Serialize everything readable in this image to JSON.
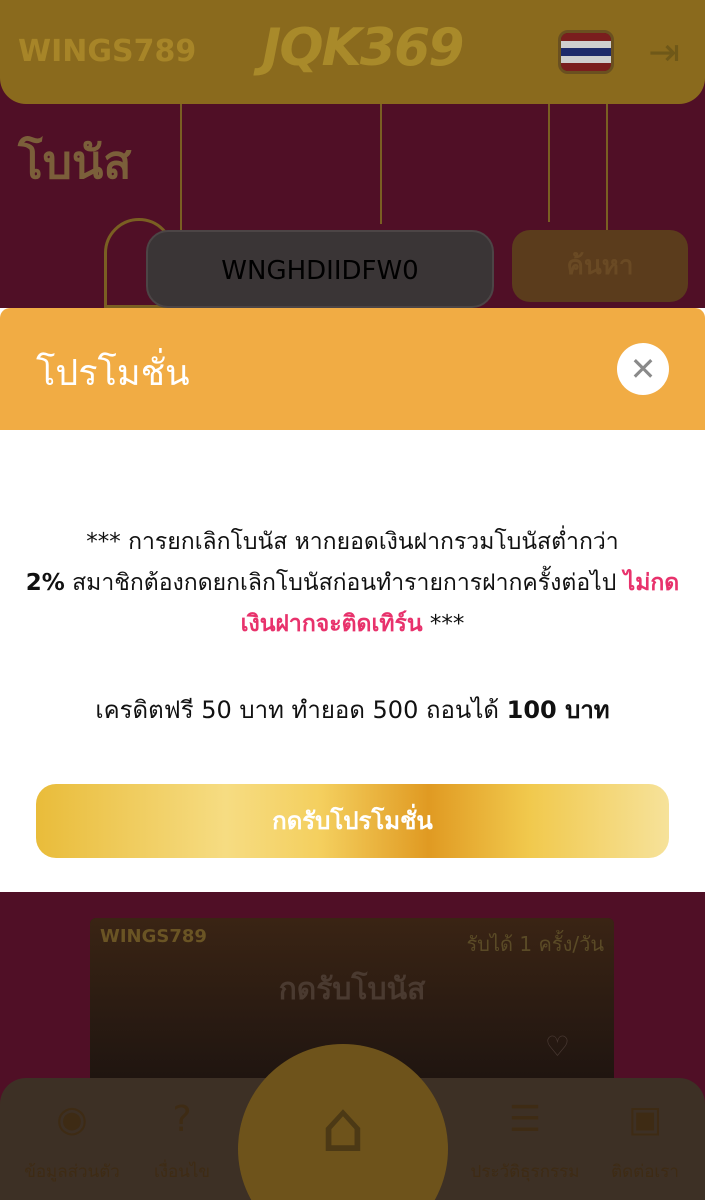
{
  "header": {
    "brand": "WINGS789",
    "logo": "JQK369",
    "flag_icon": "thailand-flag-icon",
    "logout_icon": "logout-icon"
  },
  "page": {
    "title": "โบนัส",
    "search_value": "WNGHDIIDFW0",
    "search_button": "ค้นหา"
  },
  "modal": {
    "title": "โปรโมชั่น",
    "close_icon": "close-icon",
    "text_part1": "*** การยกเลิกโบนัส หากยอดเงินฝากรวมโบนัสต่ำกว่า",
    "text_bold": "2%",
    "text_part2": "สมาชิกต้องกดยกเลิกโบนัสก่อนทำรายการฝากครั้งต่อไป",
    "text_warning": "ไม่กดเงินฝากจะติดเทิร์น",
    "text_end": "***",
    "credit_part1": "เครดิตฟรี 50 บาท ทำยอด 500 ถอนได้",
    "credit_bold": "100 บาท",
    "accept_button": "กดรับโปรโมชั่น"
  },
  "banner": {
    "logo": "WINGS789",
    "tag": "รับได้ 1 ครั้ง/วัน",
    "title": "กดรับโบนัส"
  },
  "bottom_nav": {
    "items": [
      {
        "label": "ข้อมูลส่วนตัว",
        "icon": "user-icon"
      },
      {
        "label": "เงื่อนไข",
        "icon": "question-icon"
      },
      {
        "label": "",
        "icon": "home-icon"
      },
      {
        "label": "ประวัติธุรกรรม",
        "icon": "list-icon"
      },
      {
        "label": "ติดต่อเรา",
        "icon": "line-icon"
      }
    ]
  },
  "colors": {
    "modal_header": "#f1ac44",
    "warning": "#e8326c",
    "background": "#500f26"
  }
}
